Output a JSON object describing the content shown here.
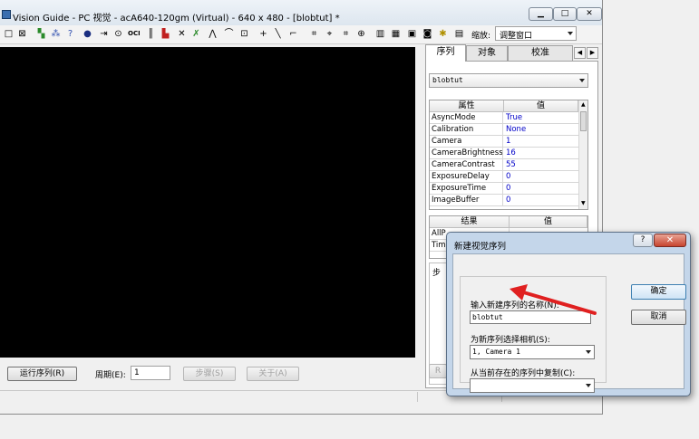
{
  "window": {
    "title": "Vision Guide - PC 视觉 - acA640-120gm (Virtual) - 640 x 480 - [blobtut] *",
    "minimize_glyph": "▁",
    "maximize_glyph": "□",
    "close_glyph": "✕"
  },
  "toolbar": {
    "icons": [
      "new-icon",
      "delete-icon",
      "sequence-icon",
      "object-icon",
      "help-query-icon",
      "blob-icon",
      "arrow-icon",
      "geometric-icon",
      "ocr-icon",
      "barcode-icon",
      "color-icon",
      "edge-icon",
      "polar-icon",
      "line-find-icon",
      "arc-icon",
      "frame-icon",
      "cross-icon",
      "line-icon",
      "calib-icon",
      "calib2-icon",
      "point-icon",
      "histogram-icon",
      "display-icon",
      "save-icon",
      "camera-icon",
      "robot-icon",
      "settings-icon"
    ],
    "zoom_label": "缩放:",
    "zoom_value": "调整窗口"
  },
  "bottom_bar": {
    "run_sequence": "运行序列(R)",
    "period_label": "周期(E):",
    "period_value": "1",
    "step": "步骤(S)",
    "close": "关于(A)"
  },
  "right_panel": {
    "tabs": [
      "序列",
      "对象",
      "校准"
    ],
    "active_tab": "序列",
    "sequence_value": "blobtut",
    "property_header": [
      "属性",
      "值"
    ],
    "properties": [
      {
        "name": "AsyncMode",
        "value": "True"
      },
      {
        "name": "Calibration",
        "value": "None"
      },
      {
        "name": "Camera",
        "value": "1"
      },
      {
        "name": "CameraBrightness",
        "value": "16"
      },
      {
        "name": "CameraContrast",
        "value": "55"
      },
      {
        "name": "ExposureDelay",
        "value": "0"
      },
      {
        "name": "ExposureTime",
        "value": "0"
      },
      {
        "name": "ImageBuffer",
        "value": "0"
      }
    ],
    "result_header": [
      "结果",
      "值"
    ],
    "results_partial": [
      "AllP",
      "Tim"
    ],
    "steps_group_label_partial": "步",
    "partial_button": "R"
  },
  "dialog": {
    "title": "新建视觉序列",
    "help_glyph": "?",
    "close_glyph": "✕",
    "name_label": "输入新建序列的名称(N):",
    "name_value": "blobtut",
    "camera_label": "为新序列选择相机(S):",
    "camera_value": "1, Camera 1",
    "copy_label": "从当前存在的序列中复制(C):",
    "copy_value": "",
    "ok": "确定",
    "cancel": "取消"
  },
  "colors": {
    "annotation_arrow": "#e02020",
    "property_value": "#0000c8",
    "image_view_bg": "#000000"
  }
}
